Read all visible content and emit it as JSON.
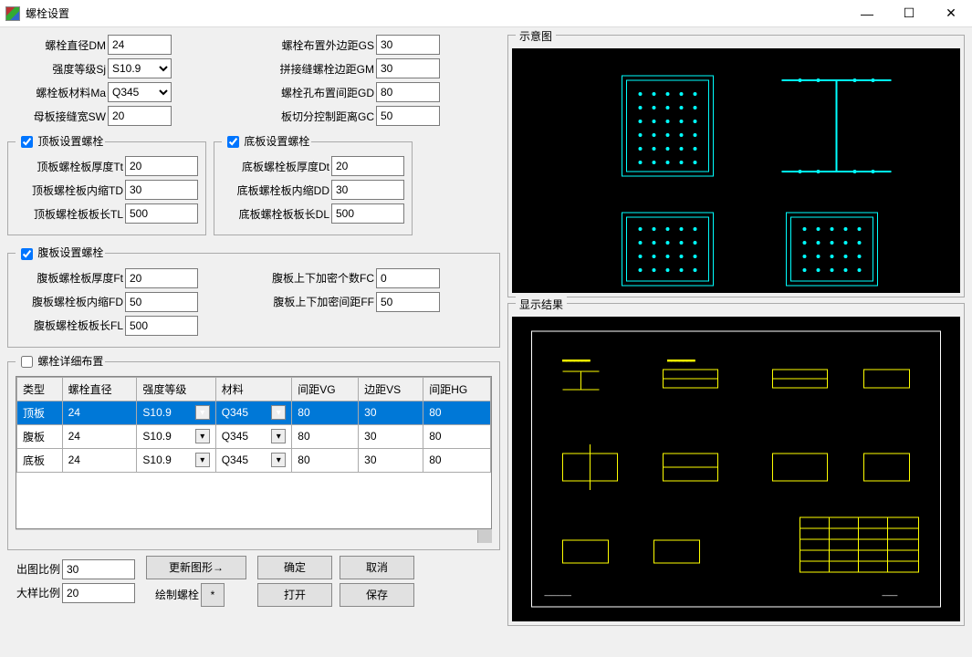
{
  "window": {
    "title": "螺栓设置"
  },
  "basic": {
    "dm_label": "螺栓直径DM",
    "dm": "24",
    "sj_label": "强度等级Sj",
    "sj": "S10.9",
    "ma_label": "螺栓板材料Ma",
    "ma": "Q345",
    "sw_label": "母板接缝宽SW",
    "sw": "20",
    "gs_label": "螺栓布置外边距GS",
    "gs": "30",
    "gm_label": "拼接缝螺栓边距GM",
    "gm": "30",
    "gd_label": "螺栓孔布置间距GD",
    "gd": "80",
    "gc_label": "板切分控制距离GC",
    "gc": "50"
  },
  "top": {
    "legend": "顶板设置螺栓",
    "tt_label": "顶板螺栓板厚度Tt",
    "tt": "20",
    "td_label": "顶板螺栓板内缩TD",
    "td": "30",
    "tl_label": "顶板螺栓板板长TL",
    "tl": "500"
  },
  "bot": {
    "legend": "底板设置螺栓",
    "dt_label": "底板螺栓板厚度Dt",
    "dt": "20",
    "dd_label": "底板螺栓板内缩DD",
    "dd": "30",
    "dl_label": "底板螺栓板板长DL",
    "dl": "500"
  },
  "web": {
    "legend": "腹板设置螺栓",
    "ft_label": "腹板螺栓板厚度Ft",
    "ft": "20",
    "fd_label": "腹板螺栓板内缩FD",
    "fd": "50",
    "fl_label": "腹板螺栓板板长FL",
    "fl": "500",
    "fc_label": "腹板上下加密个数FC",
    "fc": "0",
    "ff_label": "腹板上下加密间距FF",
    "ff": "50"
  },
  "detail": {
    "legend": "螺栓详细布置",
    "headers": [
      "类型",
      "螺栓直径",
      "强度等级",
      "材料",
      "间距VG",
      "边距VS",
      "间距HG"
    ],
    "rows": [
      {
        "type": "顶板",
        "dia": "24",
        "grade": "S10.9",
        "mat": "Q345",
        "vg": "80",
        "vs": "30",
        "hg": "80"
      },
      {
        "type": "腹板",
        "dia": "24",
        "grade": "S10.9",
        "mat": "Q345",
        "vg": "80",
        "vs": "30",
        "hg": "80"
      },
      {
        "type": "底板",
        "dia": "24",
        "grade": "S10.9",
        "mat": "Q345",
        "vg": "80",
        "vs": "30",
        "hg": "80"
      }
    ]
  },
  "scales": {
    "out_label": "出图比例",
    "out": "30",
    "big_label": "大样比例",
    "big": "20"
  },
  "buttons": {
    "update": "更新图形→",
    "draw_label": "绘制螺栓",
    "draw_btn": "*",
    "ok": "确定",
    "cancel": "取消",
    "open": "打开",
    "save": "保存"
  },
  "previews": {
    "schematic": "示意图",
    "result": "显示结果"
  }
}
